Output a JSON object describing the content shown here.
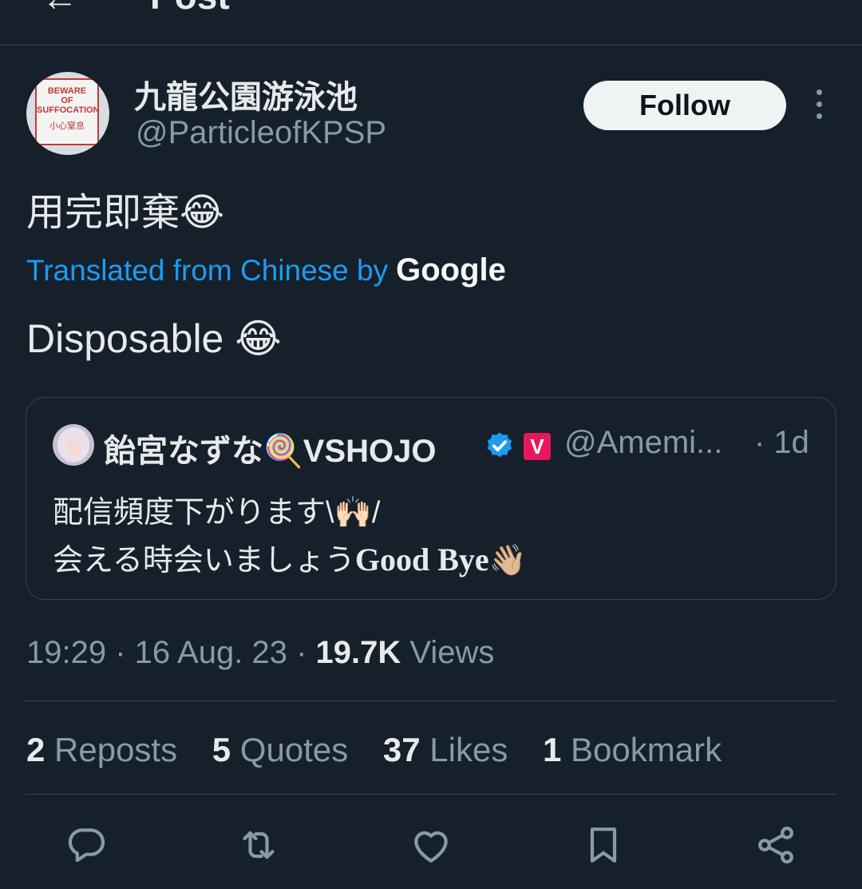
{
  "header": {
    "back_icon": "arrow-left-icon",
    "title": "Post"
  },
  "author": {
    "name": "九龍公園游泳池",
    "handle": "@ParticleofKPSP",
    "avatar_sign": [
      "BEWARE",
      "OF",
      "SUFFOCATION",
      "小心窒息"
    ]
  },
  "follow_label": "Follow",
  "post": {
    "text": "用完即棄😂",
    "translated_label": "Translated from Chinese by",
    "translated_by": "Google",
    "translation": "Disposable 😂"
  },
  "quote": {
    "name": "飴宮なずな🍭VSHOJO",
    "badge": "V",
    "handle": "@Amemi...",
    "time": "· 1d",
    "line1": "配信頻度下がります\\🙌🏻/",
    "line2_text": "会える時会いましょう",
    "line2_bold": "Good Bye",
    "line2_emoji": "👋🏼"
  },
  "meta": {
    "time": "19:29",
    "sep1": " · ",
    "date": "16 Aug. 23",
    "sep2": " · ",
    "views_count": "19.7K",
    "views_label": " Views"
  },
  "stats": [
    {
      "count": "2",
      "label": " Reposts"
    },
    {
      "count": "5",
      "label": " Quotes"
    },
    {
      "count": "37",
      "label": " Likes"
    },
    {
      "count": "1",
      "label": " Bookmark"
    }
  ],
  "actions": [
    "reply-icon",
    "repost-icon",
    "like-icon",
    "bookmark-icon",
    "share-icon"
  ],
  "colors": {
    "background": "#15202b",
    "accent": "#1d9bf0",
    "muted": "#8b98a5",
    "divider": "#38444d"
  }
}
